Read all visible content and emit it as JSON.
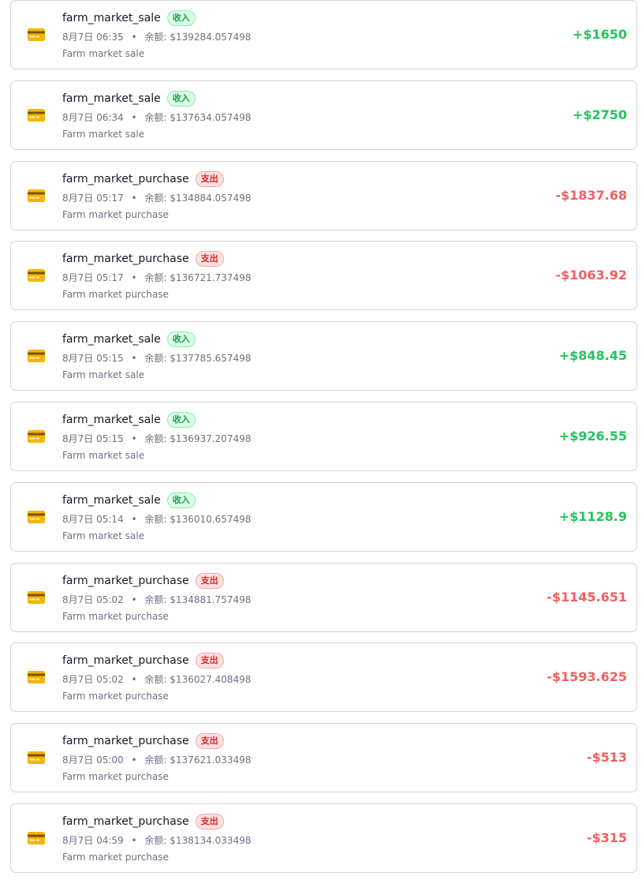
{
  "transactions": [
    {
      "title": "farm_market_sale",
      "badge": "收入",
      "kind": "income",
      "time": "8月7日 06:35",
      "balance_label": "余额:",
      "balance": "$139284.057498",
      "description": "Farm market sale",
      "amount": "+$1650"
    },
    {
      "title": "farm_market_sale",
      "badge": "收入",
      "kind": "income",
      "time": "8月7日 06:34",
      "balance_label": "余额:",
      "balance": "$137634.057498",
      "description": "Farm market sale",
      "amount": "+$2750"
    },
    {
      "title": "farm_market_purchase",
      "badge": "支出",
      "kind": "expense",
      "time": "8月7日 05:17",
      "balance_label": "余额:",
      "balance": "$134884.057498",
      "description": "Farm market purchase",
      "amount": "-$1837.68"
    },
    {
      "title": "farm_market_purchase",
      "badge": "支出",
      "kind": "expense",
      "time": "8月7日 05:17",
      "balance_label": "余额:",
      "balance": "$136721.737498",
      "description": "Farm market purchase",
      "amount": "-$1063.92"
    },
    {
      "title": "farm_market_sale",
      "badge": "收入",
      "kind": "income",
      "time": "8月7日 05:15",
      "balance_label": "余额:",
      "balance": "$137785.657498",
      "description": "Farm market sale",
      "amount": "+$848.45"
    },
    {
      "title": "farm_market_sale",
      "badge": "收入",
      "kind": "income",
      "time": "8月7日 05:15",
      "balance_label": "余额:",
      "balance": "$136937.207498",
      "description": "Farm market sale",
      "amount": "+$926.55"
    },
    {
      "title": "farm_market_sale",
      "badge": "收入",
      "kind": "income",
      "time": "8月7日 05:14",
      "balance_label": "余额:",
      "balance": "$136010.657498",
      "description": "Farm market sale",
      "amount": "+$1128.9"
    },
    {
      "title": "farm_market_purchase",
      "badge": "支出",
      "kind": "expense",
      "time": "8月7日 05:02",
      "balance_label": "余额:",
      "balance": "$134881.757498",
      "description": "Farm market purchase",
      "amount": "-$1145.651"
    },
    {
      "title": "farm_market_purchase",
      "badge": "支出",
      "kind": "expense",
      "time": "8月7日 05:02",
      "balance_label": "余额:",
      "balance": "$136027.408498",
      "description": "Farm market purchase",
      "amount": "-$1593.625"
    },
    {
      "title": "farm_market_purchase",
      "badge": "支出",
      "kind": "expense",
      "time": "8月7日 05:00",
      "balance_label": "余额:",
      "balance": "$137621.033498",
      "description": "Farm market purchase",
      "amount": "-$513"
    },
    {
      "title": "farm_market_purchase",
      "badge": "支出",
      "kind": "expense",
      "time": "8月7日 04:59",
      "balance_label": "余额:",
      "balance": "$138134.033498",
      "description": "Farm market purchase",
      "amount": "-$315"
    }
  ],
  "separator": "•",
  "icon": "credit-card-icon",
  "colors": {
    "income": "#22c55e",
    "expense": "#f25f5f",
    "income_badge_bg": "#dcfce7",
    "expense_badge_bg": "#fee2e2",
    "card_icon": "#f5b400"
  }
}
